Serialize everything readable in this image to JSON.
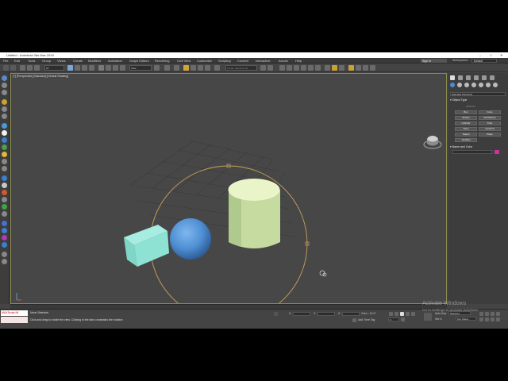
{
  "window": {
    "title": "Untitled - Autodesk 3ds Max 2019"
  },
  "menu": [
    "File",
    "Edit",
    "Tools",
    "Group",
    "Views",
    "Create",
    "Modifiers",
    "Animation",
    "Graph Editors",
    "Rendering",
    "Civil View",
    "Customize",
    "Scripting",
    "Content",
    "Interactive",
    "Arnold",
    "Help"
  ],
  "account": {
    "signin_label": "Sign In",
    "workspaces_label": "Workspaces:",
    "workspace_value": "Default"
  },
  "toolbar": {
    "selection_filter": "All",
    "view_dropdown": "View",
    "selection_set_placeholder": "Create Selection Se"
  },
  "viewport": {
    "label": "[+] [Perspective] [Standard] [Default Shading]"
  },
  "command_panel": {
    "category": "Standard Primitives",
    "object_type_title": "Object Type",
    "autogrid_label": "AutoGrid",
    "objects": [
      "Box",
      "Cone",
      "Sphere",
      "GeoSphere",
      "Cylinder",
      "Tube",
      "Torus",
      "Pyramid",
      "Teapot",
      "Plane",
      "TextPlus"
    ],
    "name_color_title": "Name and Color",
    "swatch_color": "#c8339c"
  },
  "status": {
    "maxscript_text": "MAXScript Mi",
    "selection_status": "None Selected",
    "prompt": "Click and drag to rotate the view.  Clicking in the tabs constrains the rotation",
    "x_label": "X:",
    "y_label": "Y:",
    "z_label": "Z:",
    "grid_text": "Grid = 10.0\"",
    "add_time_tag": "Add Time Tag",
    "auto_key": "Auto Key",
    "selected_value": "Selected",
    "set_key": "Set K.",
    "key_filters": "Key Filters...",
    "frame_value": "0"
  },
  "watermark": {
    "line1": "Activate Windows",
    "line2": "Go to Settings to activate Windows."
  }
}
